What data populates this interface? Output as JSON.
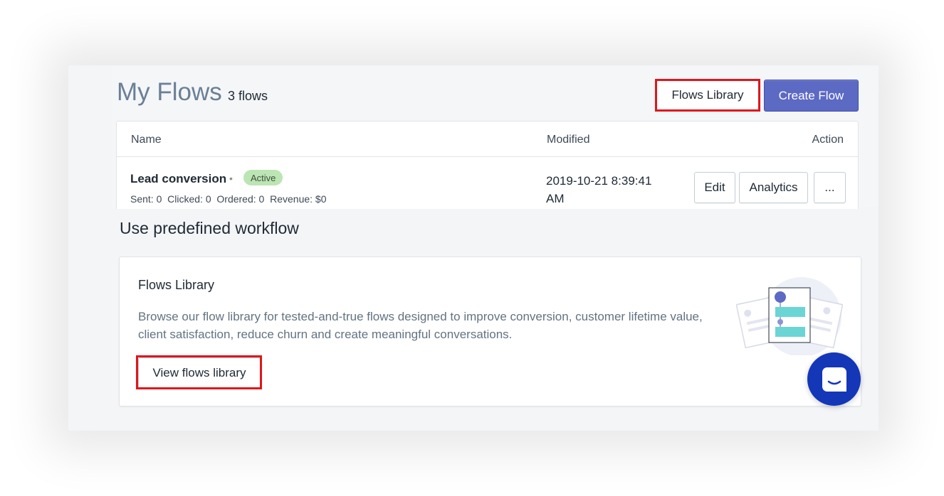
{
  "header": {
    "title": "My Flows",
    "count": "3 flows",
    "library_button": "Flows Library",
    "create_button": "Create Flow"
  },
  "table": {
    "columns": [
      "Name",
      "Modified",
      "Action"
    ],
    "rows": [
      {
        "name": "Lead conversion",
        "status": "Active",
        "stats": "Sent: 0  Clicked: 0  Ordered: 0  Revenue: $0",
        "modified": "2019-10-21 8:39:41 AM",
        "actions": [
          "Edit",
          "Analytics",
          "..."
        ]
      }
    ]
  },
  "predefined": {
    "section_title": "Use predefined workflow",
    "card_title": "Flows Library",
    "description": "Browse our flow library for tested-and-true flows designed to improve conversion, customer lifetime value, client satisfaction, reduce churn and create meaningful conversations.",
    "button": "View flows library"
  },
  "colors": {
    "accent": "#5c6ac4",
    "highlight": "#e0161b",
    "badge": "#bbe5b3",
    "chat": "#1437b8"
  },
  "icons": [
    "flow-diagram-illustration",
    "chat-icon"
  ]
}
